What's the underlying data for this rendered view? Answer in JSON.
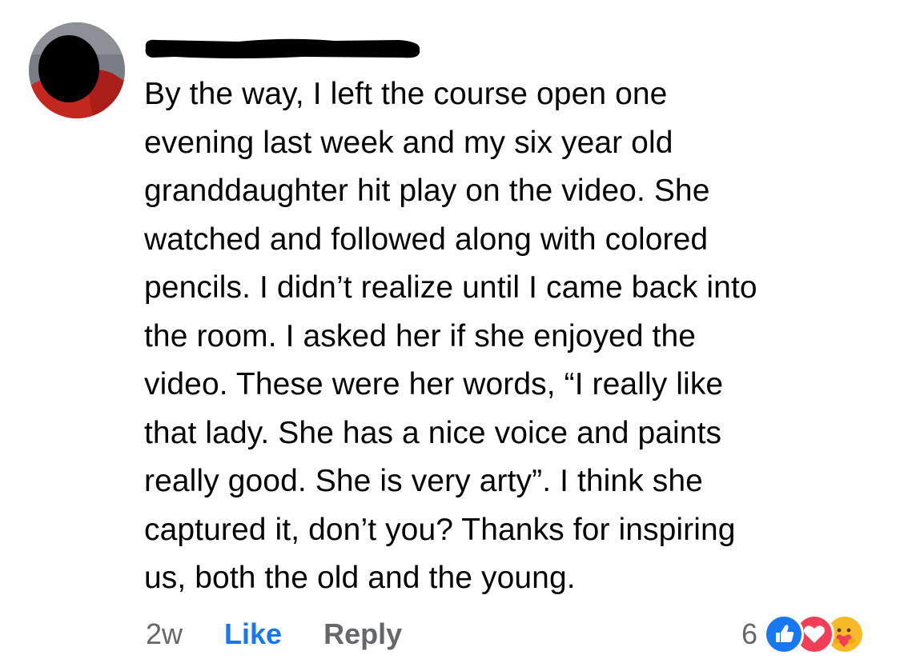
{
  "comment": {
    "author_redacted": true,
    "text_lines": [
      "By the way, I left the course open one",
      "evening last week and my six year old",
      "granddaughter hit play on the video. She",
      "watched and followed along with colored",
      "pencils. I didn’t realize until I came back into",
      "the room. I asked her if she enjoyed the",
      "video. These were her words, “I really like",
      "that lady. She has a nice voice and paints",
      "really good. She is very arty”. I think she",
      "captured it, don’t you? Thanks for inspiring",
      "us, both the old and the young."
    ]
  },
  "actions": {
    "time": "2w",
    "like_label": "Like",
    "reply_label": "Reply"
  },
  "reactions": {
    "count": "6",
    "icons": [
      "like-icon",
      "love-icon",
      "care-icon"
    ]
  },
  "colors": {
    "like_blue": "#1877f2",
    "secondary_gray": "#65676b",
    "love_red": "#f33e58",
    "care_yellow": "#f7b928"
  }
}
